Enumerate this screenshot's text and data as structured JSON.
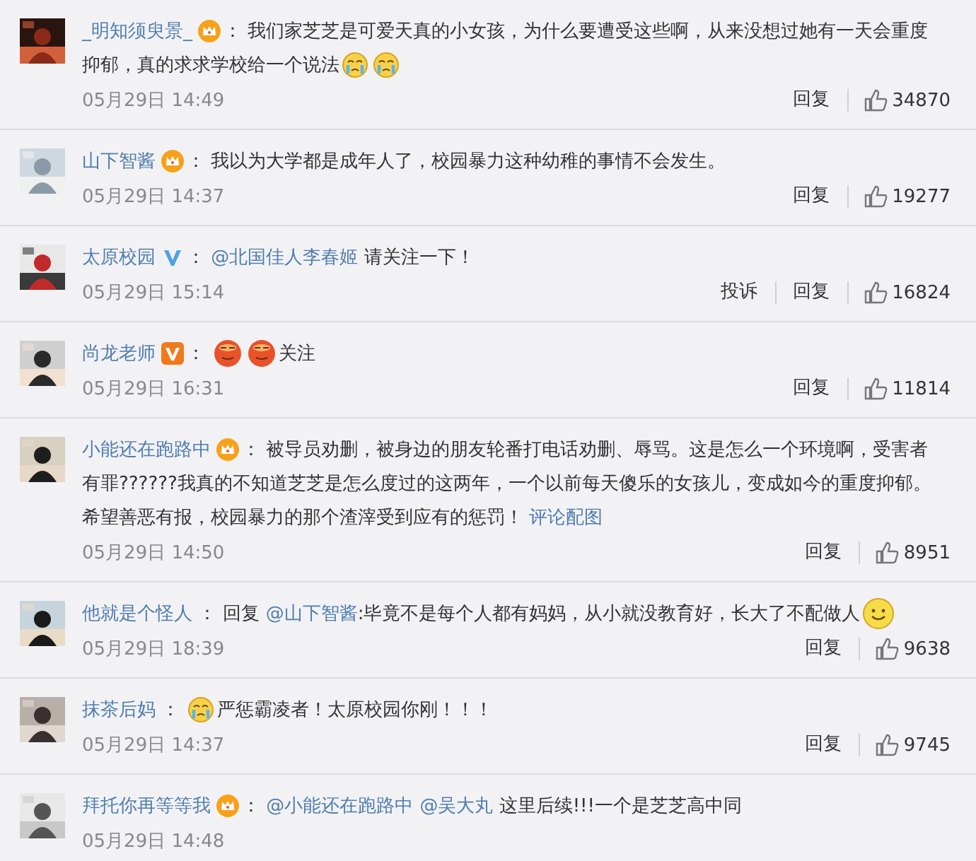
{
  "comments": [
    {
      "user": "_明知须臾景_",
      "badge": {
        "kind": "crown"
      },
      "content": [
        {
          "kind": "text",
          "text": "： 我们家芝芝是可爱天真的小女孩，为什么要遭受这些啊，从来没想过她有一天会重度抑郁，真的求求学校给一个说法"
        },
        {
          "kind": "emoji-cry"
        },
        {
          "kind": "emoji-cry"
        }
      ],
      "date": "05月29日 14:49",
      "actions": [
        "回复"
      ],
      "likes": "34870"
    },
    {
      "user": "山下智酱",
      "badge": {
        "kind": "crown"
      },
      "content": [
        {
          "kind": "text",
          "text": "： 我以为大学都是成年人了，校园暴力这种幼稚的事情不会发生。"
        }
      ],
      "date": "05月29日 14:37",
      "actions": [
        "回复"
      ],
      "likes": "19277"
    },
    {
      "user": "太原校园",
      "badge": {
        "kind": "verified-blue"
      },
      "content": [
        {
          "kind": "text",
          "text": "： "
        },
        {
          "kind": "mention",
          "text": "@北国佳人李春姬"
        },
        {
          "kind": "text",
          "text": " 请关注一下！"
        }
      ],
      "date": "05月29日 15:14",
      "actions": [
        "投诉",
        "回复"
      ],
      "likes": "16824"
    },
    {
      "user": "尚龙老师",
      "badge": {
        "kind": "verified-orange"
      },
      "content": [
        {
          "kind": "text",
          "text": "： "
        },
        {
          "kind": "emoji-red"
        },
        {
          "kind": "emoji-red"
        },
        {
          "kind": "text",
          "text": "关注"
        }
      ],
      "date": "05月29日 16:31",
      "actions": [
        "回复"
      ],
      "likes": "11814"
    },
    {
      "user": "小能还在跑路中",
      "badge": {
        "kind": "crown"
      },
      "content": [
        {
          "kind": "text",
          "text": "： 被导员劝删，被身边的朋友轮番打电话劝删、辱骂。这是怎么一个环境啊，受害者有罪??????我真的不知道芝芝是怎么度过的这两年，一个以前每天傻乐的女孩儿，变成如今的重度抑郁。希望善恶有报，校园暴力的那个渣滓受到应有的惩罚！ "
        },
        {
          "kind": "link",
          "text": "评论配图"
        }
      ],
      "date": "05月29日 14:50",
      "actions": [
        "回复"
      ],
      "likes": "8951"
    },
    {
      "user": "他就是个怪人",
      "content": [
        {
          "kind": "text",
          "text": " ： 回复"
        },
        {
          "kind": "mention",
          "text": "@山下智酱"
        },
        {
          "kind": "text",
          "text": ":毕竟不是每个人都有妈妈，从小就没教育好，长大了不配做人"
        },
        {
          "kind": "emoji-smile"
        }
      ],
      "date": "05月29日 18:39",
      "actions": [
        "回复"
      ],
      "likes": "9638"
    },
    {
      "user": "抹茶后妈",
      "content": [
        {
          "kind": "text",
          "text": " ： "
        },
        {
          "kind": "emoji-cry"
        },
        {
          "kind": "text",
          "text": "严惩霸凌者！太原校园你刚！！！"
        }
      ],
      "date": "05月29日 14:37",
      "actions": [
        "回复"
      ],
      "likes": "9745"
    },
    {
      "user": "拜托你再等等我",
      "badge": {
        "kind": "crown"
      },
      "content": [
        {
          "kind": "text",
          "text": "： "
        },
        {
          "kind": "mention",
          "text": "@小能还在跑路中"
        },
        {
          "kind": "mention",
          "text": "@吴大丸"
        },
        {
          "kind": "text",
          "text": " 这里后续!!!一个是芝芝高中同"
        }
      ],
      "date": "05月29日 14:48"
    }
  ]
}
